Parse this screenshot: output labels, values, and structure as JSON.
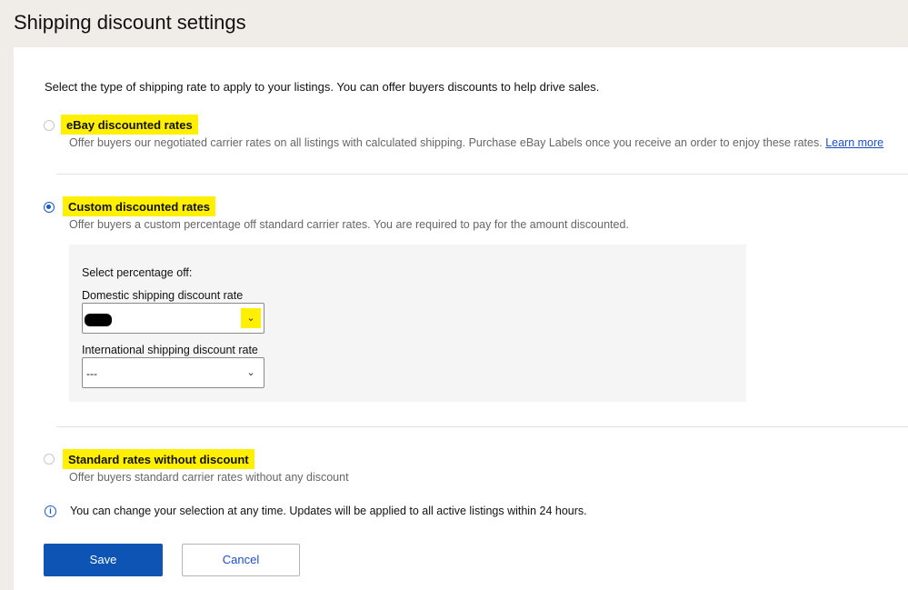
{
  "page": {
    "title": "Shipping discount settings"
  },
  "intro": "Select the type of shipping rate to apply to your listings. You can offer buyers discounts to help drive sales.",
  "options": [
    {
      "title": "eBay discounted rates",
      "description": "Offer buyers our negotiated carrier rates on all listings with calculated shipping. Purchase eBay Labels once you receive an order to enjoy these rates.",
      "link": "Learn more",
      "selected": false
    },
    {
      "title": "Custom discounted rates",
      "description": "Offer buyers a custom percentage off standard carrier rates. You are required to pay for the amount discounted.",
      "selected": true
    },
    {
      "title": "Standard rates without discount",
      "description": "Offer buyers standard carrier rates without any discount",
      "selected": false
    }
  ],
  "discount_box": {
    "heading": "Select percentage off:",
    "domestic_label": "Domestic shipping discount rate",
    "domestic_value": "",
    "international_label": "International shipping discount rate",
    "international_value": "---"
  },
  "info": "You can change your selection at any time. Updates will be applied to all active listings within 24 hours.",
  "buttons": {
    "save": "Save",
    "cancel": "Cancel"
  },
  "icons": {
    "info": "info-circle-icon",
    "chevron": "chevron-down-icon"
  },
  "colors": {
    "accent": "#0e54b5",
    "highlight": "#ffef00",
    "link": "#1a4fc4"
  }
}
